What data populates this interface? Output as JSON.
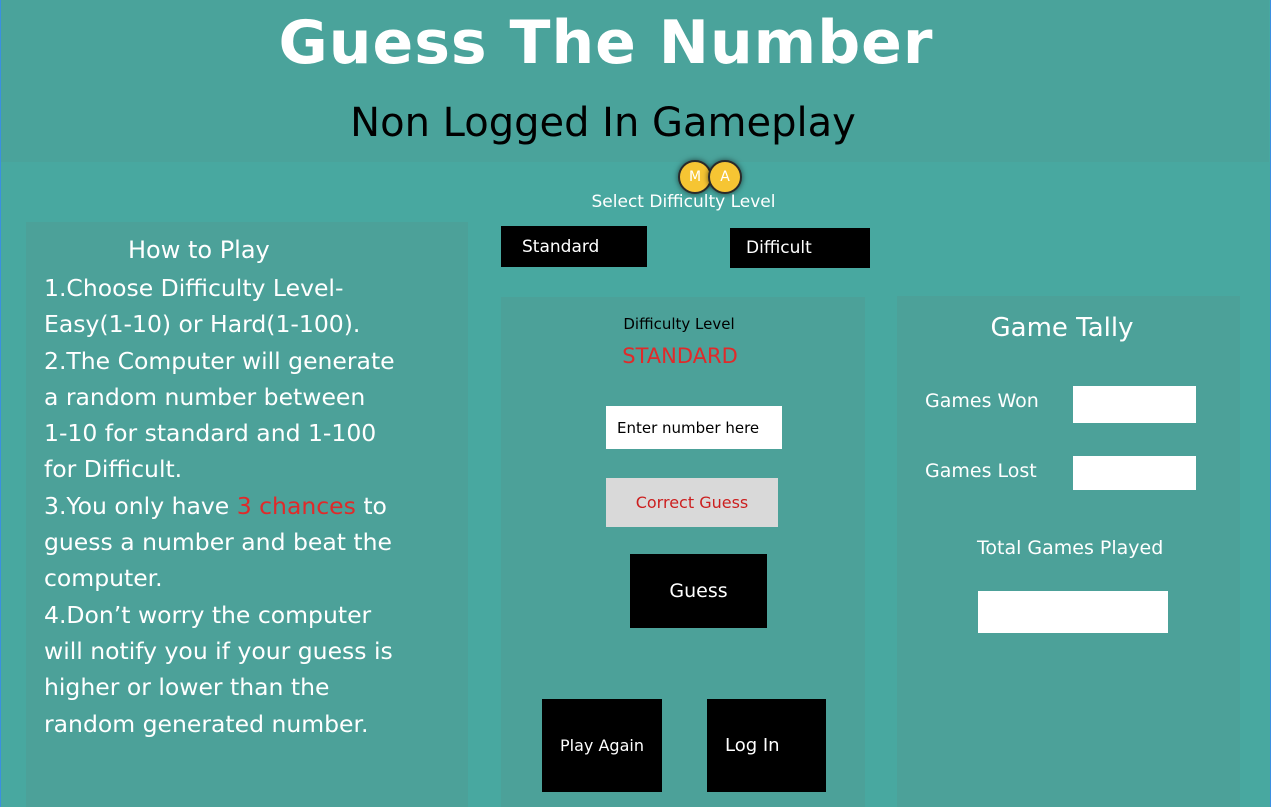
{
  "header": {
    "title": "Guess The Number",
    "subtitle": "Non Logged In Gameplay"
  },
  "avatars": [
    "M",
    "A"
  ],
  "difficulty_select": {
    "label": "Select Difficulty Level",
    "standard_label": "Standard",
    "difficult_label": "Difficult"
  },
  "how_to_play": {
    "title": "How to Play",
    "lines": [
      "1.Choose Difficulty Level-",
      "Easy(1-10) or Hard(1-100).",
      "2.The Computer will generate",
      "a random number between",
      "1-10 for standard and 1-100",
      "for Difficult."
    ],
    "line3_prefix": "3.You only have ",
    "line3_highlight": "3 chances",
    "line3_suffix": " to",
    "lines_after": [
      "guess a number and beat the",
      "computer.",
      "4.Don’t worry the computer",
      "will notify you if your guess is",
      "higher or lower than the",
      "random generated number."
    ]
  },
  "game": {
    "difficulty_label": "Difficulty Level",
    "difficulty_value": "STANDARD",
    "input_placeholder": "Enter number here",
    "feedback": "Correct Guess",
    "guess_button": "Guess",
    "play_again_button": "Play Again",
    "login_button": "Log In"
  },
  "tally": {
    "title": "Game Tally",
    "won_label": "Games Won",
    "lost_label": "Games Lost",
    "total_label": "Total Games Played"
  },
  "colors": {
    "background": "#48a8a0",
    "panel": "#4ca199",
    "accent_red": "#e02a2a",
    "button": "#000000"
  }
}
